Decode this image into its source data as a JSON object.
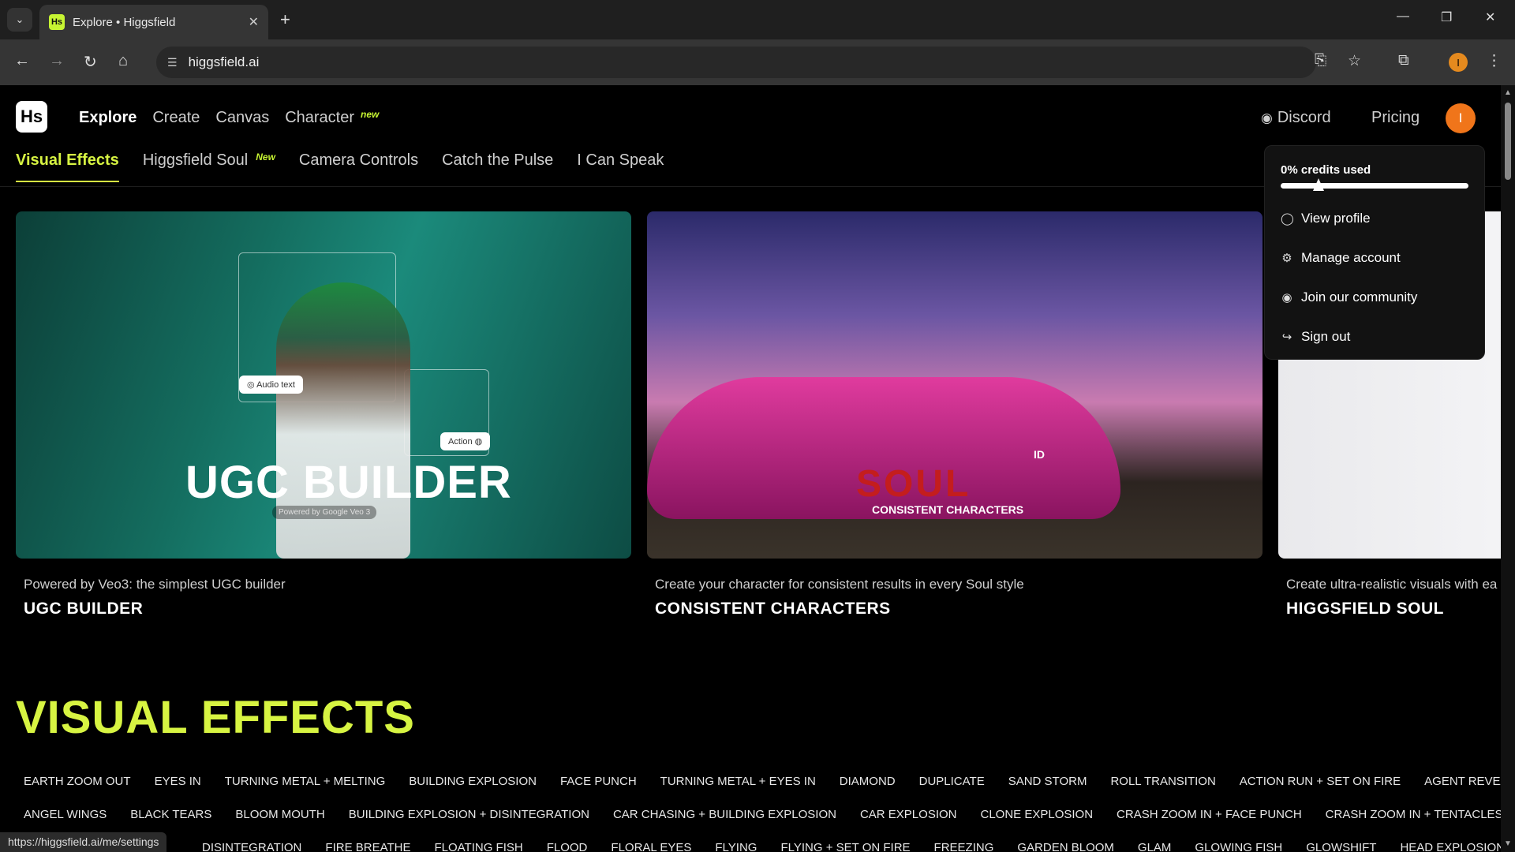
{
  "browser": {
    "tab_title": "Explore • Higgsfield",
    "url": "higgsfield.ai",
    "status_url": "https://higgsfield.ai/me/settings",
    "profile_initial": "I"
  },
  "header": {
    "logo_text": "Hs",
    "nav": [
      {
        "label": "Explore"
      },
      {
        "label": "Create"
      },
      {
        "label": "Canvas"
      },
      {
        "label": "Character",
        "badge": "new"
      }
    ],
    "discord_label": "Discord",
    "pricing_label": "Pricing",
    "avatar_initial": "I"
  },
  "subnav": [
    {
      "label": "Visual Effects"
    },
    {
      "label": "Higgsfield Soul",
      "badge": "New"
    },
    {
      "label": "Camera Controls"
    },
    {
      "label": "Catch the Pulse"
    },
    {
      "label": "I Can Speak"
    }
  ],
  "cards": [
    {
      "desc": "Powered by Veo3: the simplest UGC builder",
      "title": "UGC BUILDER",
      "image_title": "UGC  BUILDER",
      "image_sub": "Powered by Google Veo 3",
      "chip_audio": "Audio text",
      "chip_action": "Action"
    },
    {
      "desc": "Create your character for consistent results in every Soul style",
      "title": "CONSISTENT CHARACTERS",
      "image_soul": "SOUL",
      "image_id": "ID",
      "image_sub": "CONSISTENT CHARACTERS"
    },
    {
      "desc": "Create ultra-realistic visuals with ea",
      "title": "HIGGSFIELD SOUL"
    }
  ],
  "visual_effects": {
    "heading": "VISUAL EFFECTS",
    "row1": [
      "EARTH ZOOM OUT",
      "EYES IN",
      "TURNING METAL + MELTING",
      "BUILDING EXPLOSION",
      "FACE PUNCH",
      "TURNING METAL + EYES IN",
      "DIAMOND",
      "DUPLICATE",
      "SAND STORM",
      "ROLL TRANSITION",
      "ACTION RUN + SET ON FIRE",
      "AGENT REVEAL"
    ],
    "row2": [
      "ANGEL WINGS",
      "BLACK TEARS",
      "BLOOM MOUTH",
      "BUILDING EXPLOSION + DISINTEGRATION",
      "CAR CHASING + BUILDING EXPLOSION",
      "CAR EXPLOSION",
      "CLONE EXPLOSION",
      "CRASH ZOOM IN + FACE PUNCH",
      "CRASH ZOOM IN + TENTACLES"
    ],
    "row3": [
      "DISINTEGRATION",
      "FIRE BREATHE",
      "FLOATING FISH",
      "FLOOD",
      "FLORAL EYES",
      "FLYING",
      "FLYING + SET ON FIRE",
      "FREEZING",
      "GARDEN BLOOM",
      "GLAM",
      "GLOWING FISH",
      "GLOWSHIFT",
      "HEAD EXPLOSION"
    ]
  },
  "dropdown": {
    "credits_label": "0% credits used",
    "credits_used_fraction": 0.0,
    "items": [
      {
        "label": "View profile",
        "icon": "user-circle-icon"
      },
      {
        "label": "Manage account",
        "icon": "gear-icon"
      },
      {
        "label": "Join our community",
        "icon": "discord-icon"
      },
      {
        "label": "Sign out",
        "icon": "sign-out-icon"
      }
    ]
  },
  "colors": {
    "accent": "#d7f442",
    "avatar": "#f0751a"
  }
}
